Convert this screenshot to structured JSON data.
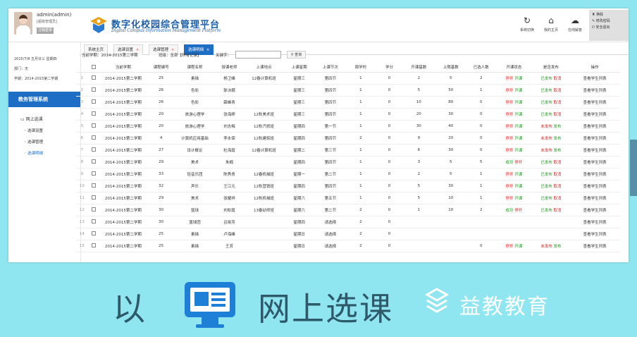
{
  "user": {
    "name": "admin(admin)",
    "role": "[超级管理员]",
    "logout": "注销登录"
  },
  "header": {
    "title": "数字化校园综合管理平台",
    "subtitle": "Digital Campus Information Management Platform",
    "tools": [
      {
        "icon": "refresh-icon",
        "label": "系统切换"
      },
      {
        "icon": "home-icon",
        "label": "我的主页"
      },
      {
        "icon": "chat-icon",
        "label": "在线解答"
      }
    ],
    "quick": [
      "换肤",
      "修改密码",
      "安全退出"
    ]
  },
  "sidebar": {
    "date": "2015/7/8  五月廿三  星期四",
    "dept": "部门：无",
    "term": "学期：2014-2015第二学期",
    "system": "教务管理系统",
    "menu_head": "网上选课",
    "items": [
      "选课设置",
      "选课管理",
      "选课明细"
    ]
  },
  "tabs": [
    {
      "label": "系统主页"
    },
    {
      "label": "选课设置"
    },
    {
      "label": "选课管理"
    },
    {
      "label": "选课明细"
    }
  ],
  "filter": {
    "term_label": "当前学期：2014-2015第二学期",
    "class_label": "班级：全部【所有记录】",
    "kw_label": "关键字：",
    "query": "查询"
  },
  "table": {
    "headers": [
      "",
      "",
      "当前学期",
      "课程编号",
      "课程名称",
      "授课老师",
      "上课地点",
      "上课星期",
      "上课节次",
      "周学时",
      "学分",
      "开课基数",
      "上限基数",
      "已选人数",
      "开课状态",
      "是否发布",
      "操作"
    ],
    "rows": [
      [
        "1",
        "2014-2015第二学期",
        "25",
        "素描",
        "杨卫峰",
        "12春计算机班",
        "星期三",
        "第四节",
        "1",
        "0",
        "2",
        "5",
        "2",
        "停开 开课",
        "已发布 取消",
        "查看学生列表"
      ],
      [
        "2",
        "2014-2015第二学期",
        "26",
        "色彩",
        "耿冰娜",
        "",
        "星期三",
        "第四节",
        "1",
        "0",
        "5",
        "50",
        "1",
        "停开 开课",
        "已发布 取消",
        "查看学生列表"
      ],
      [
        "3",
        "2014-2015第二学期",
        "26",
        "色彩",
        "薛峰青",
        "",
        "星期三",
        "第四节",
        "1",
        "0",
        "10",
        "80",
        "0",
        "停开 开课",
        "已发布 取消",
        "查看学生列表"
      ],
      [
        "4",
        "2014-2015第二学期",
        "20",
        "旅游心理学",
        "张海婷",
        "12秋美术班",
        "星期三",
        "第四节",
        "1",
        "0",
        "20",
        "30",
        "0",
        "停开 开课",
        "已发布 取消",
        "查看学生列表"
      ],
      [
        "5",
        "2014-2015第二学期",
        "20",
        "旅游心理学",
        "刘志梅",
        "12秋汽修班",
        "星期四",
        "第一节",
        "1",
        "0",
        "30",
        "40",
        "0",
        "停开 开课",
        "未发布 发布",
        "查看学生列表"
      ],
      [
        "6",
        "2014-2015第二学期",
        "4",
        "计算机应用基础",
        "李永保",
        "12秋建筑班",
        "星期四",
        "第四节",
        "2",
        "0",
        "9",
        "20",
        "0",
        "停开 开课",
        "未发布 发布",
        "查看学生列表"
      ],
      [
        "7",
        "2014-2015第二学期",
        "27",
        "设计概论",
        "杜海霞",
        "12春计算机班",
        "星期二",
        "第三节",
        "1",
        "0",
        "6",
        "30",
        "0",
        "停开 开课",
        "未发布 发布",
        "查看学生列表"
      ],
      [
        "8",
        "2014-2015第二学期",
        "29",
        "美术",
        "朱楠",
        "",
        "星期四",
        "第四节",
        "1",
        "0",
        "3",
        "5",
        "5",
        "成功 停开",
        "已发布 取消",
        "查看学生列表"
      ],
      [
        "9",
        "2014-2015第二学期",
        "33",
        "轻音乐团",
        "陈秀青",
        "12春机械班",
        "星期一",
        "第二节",
        "1",
        "0",
        "2",
        "5",
        "1",
        "停开 开课",
        "已发布 取消",
        "查看学生列表"
      ],
      [
        "10",
        "2014-2015第二学期",
        "32",
        "声乐",
        "王江元",
        "12秋营销班",
        "星期四",
        "第四节",
        "1",
        "0",
        "5",
        "30",
        "1",
        "停开 开课",
        "已发布 取消",
        "查看学生列表"
      ],
      [
        "11",
        "2014-2015第二学期",
        "29",
        "美术",
        "张耀祥",
        "12秋机械班",
        "星期六",
        "第五节",
        "1",
        "0",
        "5",
        "10",
        "1",
        "停开 开课",
        "已发布 取消",
        "查看学生列表"
      ],
      [
        "12",
        "2014-2015第二学期",
        "30",
        "篮球",
        "刘松霞",
        "13春幼师班",
        "星期六",
        "第二节",
        "2",
        "0",
        "1",
        "10",
        "2",
        "成功 停开",
        "已发布 取消",
        "查看学生列表"
      ],
      [
        "13",
        "2014-2015第二学期",
        "30",
        "篮球团",
        "吕晓芳",
        "",
        "星期四",
        "请选择",
        "2",
        "0",
        "",
        "",
        "",
        "",
        "",
        "查看学生列表"
      ],
      [
        "14",
        "2014-2015第二学期",
        "25",
        "素描",
        "卢海峰",
        "",
        "星期日",
        "请选择",
        "2",
        "0",
        "",
        "",
        "",
        "",
        "",
        "查看学生列表"
      ],
      [
        "15",
        "2014-2015第二学期",
        "25",
        "素描",
        "王芳",
        "",
        "星期日",
        "请选择",
        "2",
        "0",
        "",
        "",
        "0",
        "停开 开课",
        "未发布 发布",
        "查看学生列表"
      ]
    ]
  },
  "banner": {
    "lead": "以",
    "rest": "网上选课",
    "brand": "益教教育",
    "icon": "screen-icon"
  },
  "colors": {
    "accent": "#1e6ec6",
    "red": "#e02020",
    "green": "#1a9a1a",
    "background": "#8fe6f1"
  }
}
